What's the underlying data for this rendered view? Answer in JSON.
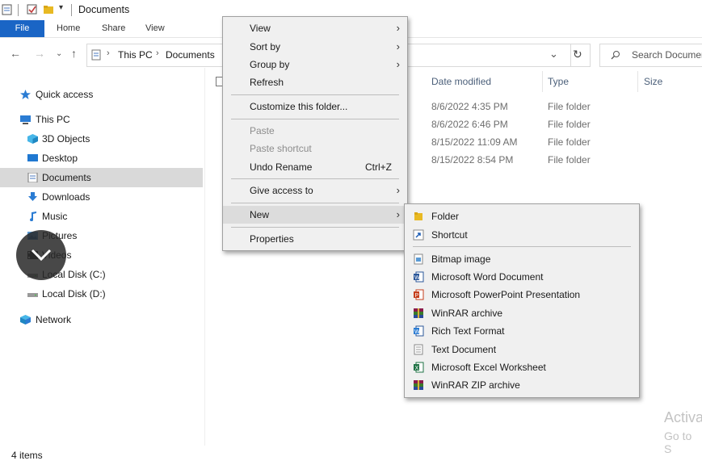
{
  "window": {
    "title": "Documents"
  },
  "ribbon": {
    "tabs": [
      "File",
      "Home",
      "Share",
      "View"
    ]
  },
  "address": {
    "crumbs": [
      "This PC",
      "Documents"
    ],
    "search_placeholder": "Search Documents"
  },
  "nav": {
    "items": [
      {
        "label": "Quick access",
        "icon": "star-icon"
      },
      {
        "label": "This PC",
        "icon": "computer-icon"
      },
      {
        "label": "3D Objects",
        "icon": "cube-icon"
      },
      {
        "label": "Desktop",
        "icon": "desktop-icon"
      },
      {
        "label": "Documents",
        "icon": "documents-icon"
      },
      {
        "label": "Downloads",
        "icon": "download-icon"
      },
      {
        "label": "Music",
        "icon": "music-icon"
      },
      {
        "label": "Pictures",
        "icon": "pictures-icon"
      },
      {
        "label": "Videos",
        "icon": "videos-icon"
      },
      {
        "label": "Local Disk (C:)",
        "icon": "drive-icon"
      },
      {
        "label": "Local Disk (D:)",
        "icon": "drive-icon"
      },
      {
        "label": "Network",
        "icon": "network-icon"
      }
    ]
  },
  "columns": {
    "date_modified": "Date modified",
    "type": "Type",
    "size": "Size"
  },
  "rows": [
    {
      "date": "8/6/2022 4:35 PM",
      "type": "File folder"
    },
    {
      "date": "8/6/2022 6:46 PM",
      "type": "File folder"
    },
    {
      "date": "8/15/2022 11:09 AM",
      "type": "File folder"
    },
    {
      "date": "8/15/2022 8:54 PM",
      "type": "File folder"
    }
  ],
  "context_menu": {
    "view": "View",
    "sort_by": "Sort by",
    "group_by": "Group by",
    "refresh": "Refresh",
    "customize": "Customize this folder...",
    "paste": "Paste",
    "paste_shortcut": "Paste shortcut",
    "undo_rename": "Undo Rename",
    "undo_shortcut": "Ctrl+Z",
    "give_access": "Give access to",
    "new": "New",
    "properties": "Properties"
  },
  "new_menu": {
    "folder": "Folder",
    "shortcut": "Shortcut",
    "bitmap": "Bitmap image",
    "word": "Microsoft Word Document",
    "powerpoint": "Microsoft PowerPoint Presentation",
    "winrar": "WinRAR archive",
    "rtf": "Rich Text Format",
    "text": "Text Document",
    "excel": "Microsoft Excel Worksheet",
    "winrar_zip": "WinRAR ZIP archive"
  },
  "status": {
    "items": "4 items"
  },
  "watermark": {
    "line1": "Activa",
    "line2": "Go to S"
  },
  "colors": {
    "accent": "#1a65c5",
    "selection": "#cce3f7",
    "menu_bg": "#f0f0f0"
  }
}
